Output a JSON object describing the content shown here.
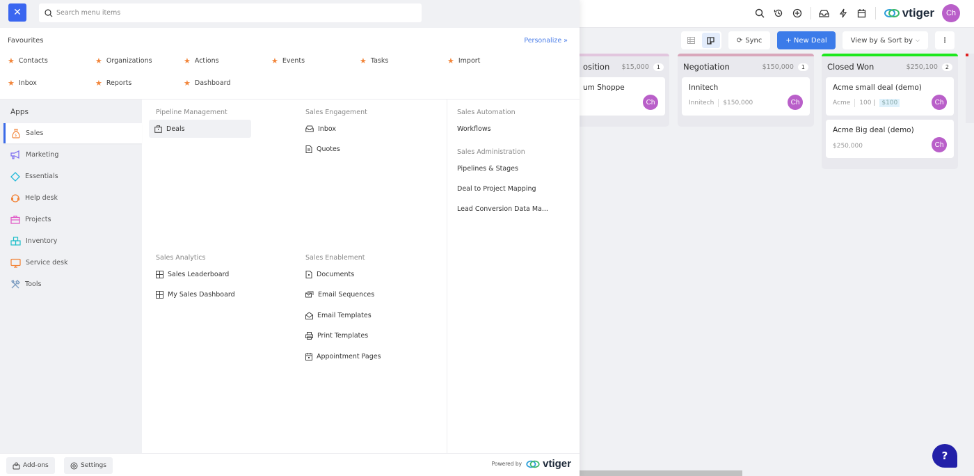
{
  "topbar": {
    "icons": [
      "search-icon",
      "history-icon",
      "add-circle-icon",
      "inbox-icon",
      "lightning-icon",
      "calendar-icon"
    ],
    "brand": "vtiger",
    "user_initials": "Ch"
  },
  "toolbar": {
    "sync_label": "Sync",
    "new_deal_label": "+ New Deal",
    "view_sort_label": "View by & Sort by",
    "view_modes": [
      "list",
      "kanban"
    ],
    "active_view": "kanban"
  },
  "pipeline": {
    "columns": [
      {
        "name": "Proposition",
        "visible_name": "osition",
        "total": "$15,000",
        "count": "1",
        "bar_color": "#e2c6de",
        "cards": [
          {
            "title": "um Shoppe",
            "meta": [],
            "owner": "Ch"
          }
        ]
      },
      {
        "name": "Negotiation",
        "total": "$150,000",
        "count": "1",
        "bar_color": "#d9a7bb",
        "cards": [
          {
            "title": "Innitech",
            "org": "Innitech",
            "amount": "$150,000",
            "owner": "Ch"
          }
        ]
      },
      {
        "name": "Closed Won",
        "total": "$250,100",
        "count": "2",
        "bar_color": "#1ee81e",
        "cards": [
          {
            "title": "Acme small deal (demo)",
            "org": "Acme",
            "qty": "100 |",
            "amount": "$100",
            "owner": "Ch"
          },
          {
            "title": "Acme Big deal (demo)",
            "amount": "$250,000",
            "owner": "Ch"
          }
        ]
      }
    ]
  },
  "help": {
    "label": "?"
  },
  "menu": {
    "close_label": "✕",
    "search_placeholder": "Search menu items",
    "favourites": {
      "title": "Favourites",
      "personalize": "Personalize »",
      "items": [
        "Contacts",
        "Organizations",
        "Actions",
        "Events",
        "Tasks",
        "Import",
        "Inbox",
        "Reports",
        "Dashboard"
      ]
    },
    "apps": {
      "title": "Apps",
      "items": [
        {
          "label": "Sales",
          "icon": "money-bag-icon",
          "color": "#f2853a",
          "active": true
        },
        {
          "label": "Marketing",
          "icon": "megaphone-icon",
          "color": "#7b6cf0"
        },
        {
          "label": "Essentials",
          "icon": "diamond-icon",
          "color": "#1fb8d8"
        },
        {
          "label": "Help desk",
          "icon": "headset-icon",
          "color": "#f2853a"
        },
        {
          "label": "Projects",
          "icon": "briefcase-icon",
          "color": "#e05bc7"
        },
        {
          "label": "Inventory",
          "icon": "boxes-icon",
          "color": "#1fbfc9"
        },
        {
          "label": "Service desk",
          "icon": "monitor-icon",
          "color": "#f2853a"
        },
        {
          "label": "Tools",
          "icon": "tools-icon",
          "color": "#7a9bc0"
        }
      ]
    },
    "sections": {
      "pipeline_management": {
        "title": "Pipeline Management",
        "items": [
          "Deals"
        ]
      },
      "sales_engagement": {
        "title": "Sales Engagement",
        "items": [
          "Inbox",
          "Quotes"
        ]
      },
      "sales_automation": {
        "title": "Sales Automation",
        "items": [
          "Workflows"
        ]
      },
      "sales_administration": {
        "title": "Sales Administration",
        "items": [
          "Pipelines & Stages",
          "Deal to Project Mapping",
          "Lead Conversion Data Ma..."
        ]
      },
      "sales_analytics": {
        "title": "Sales Analytics",
        "items": [
          "Sales Leaderboard",
          "My Sales Dashboard"
        ]
      },
      "sales_enablement": {
        "title": "Sales Enablement",
        "items": [
          "Documents",
          "Email Sequences",
          "Email Templates",
          "Print Templates",
          "Appointment Pages"
        ]
      }
    },
    "footer": {
      "addons_label": "Add-ons",
      "settings_label": "Settings",
      "powered_by": "Powered by",
      "brand": "vtiger"
    }
  }
}
